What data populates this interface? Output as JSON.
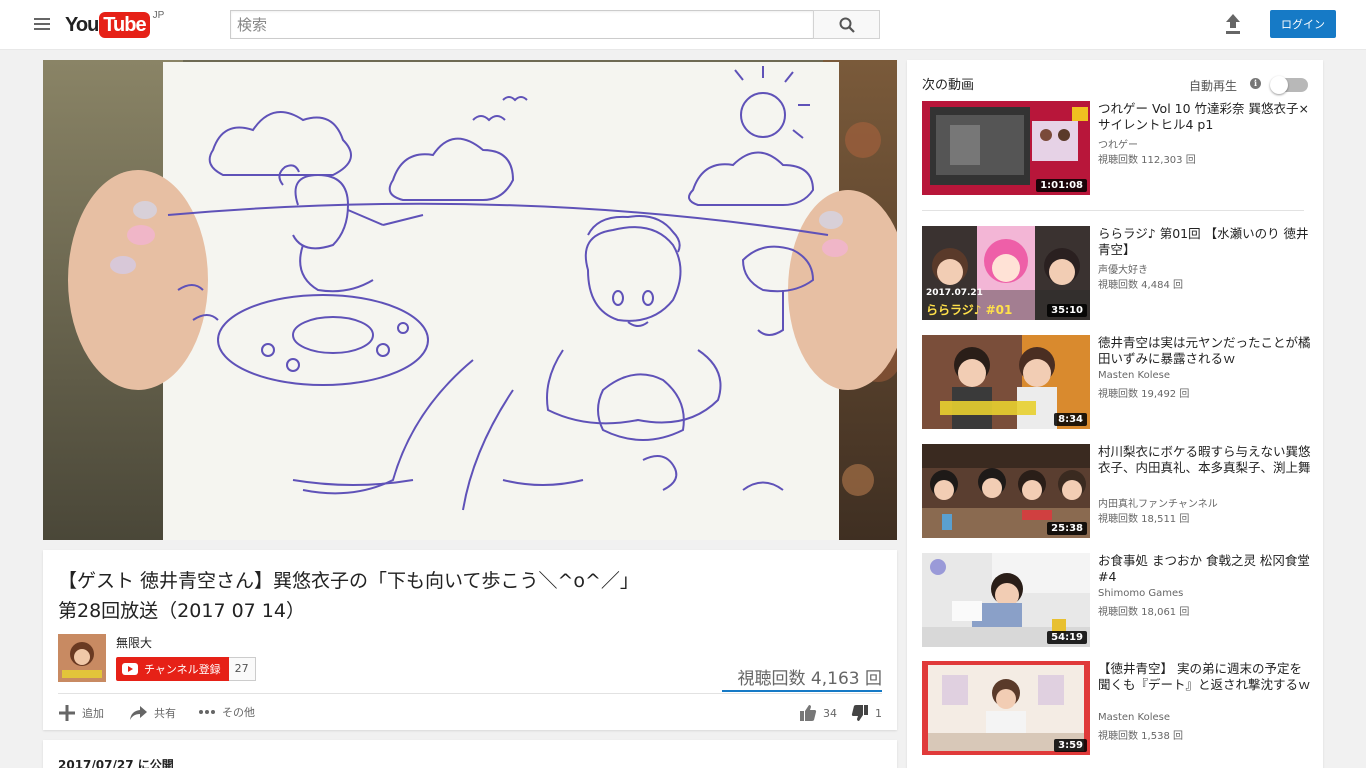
{
  "header": {
    "logo_you": "You",
    "logo_tube": "Tube",
    "logo_region": "JP",
    "search_placeholder": "検索",
    "login_label": "ログイン"
  },
  "video": {
    "title_line1": "【ゲスト 徳井青空さん】巽悠衣子の「下も向いて歩こう＼^o^／」",
    "title_line2": "第28回放送（2017 07 14）",
    "channel_name": "無限大",
    "subscribe_label": "チャンネル登録",
    "subscriber_count": "27",
    "views": "視聴回数 4,163 回",
    "actions": {
      "add": "追加",
      "share": "共有",
      "more": "その他",
      "likes": "34",
      "dislikes": "1"
    },
    "published": "2017/07/27 に公開"
  },
  "sidebar": {
    "up_next": "次の動画",
    "autoplay_label": "自動再生",
    "autoplay_info": "i",
    "items": [
      {
        "title": "つれゲー Vol 10 竹達彩奈 巽悠衣子×サイレントヒル4 p1",
        "channel": "つれゲー",
        "views": "視聴回数 112,303 回",
        "duration": "1:01:08"
      },
      {
        "title": "ららラジ♪ 第01回 【水瀬いのり 徳井青空】",
        "channel": "声優大好き",
        "views": "視聴回数 4,484 回",
        "duration": "35:10",
        "overlay_date": "2017.07.21",
        "overlay_title": "ららラジ♪ #01"
      },
      {
        "title": "徳井青空は実は元ヤンだったことが橘田いずみに暴露されるｗ",
        "channel": "Masten Kolese",
        "views": "視聴回数 19,492 回",
        "duration": "8:34"
      },
      {
        "title": "村川梨衣にボケる暇すら与えない巽悠衣子、内田真礼、本多真梨子、渕上舞",
        "channel": "内田真礼ファンチャンネル",
        "views": "視聴回数 18,511 回",
        "duration": "25:38"
      },
      {
        "title": "お食事処 まつおか 食戟之灵 松冈食堂 #4",
        "channel": "Shimomo Games",
        "views": "視聴回数 18,061 回",
        "duration": "54:19"
      },
      {
        "title": "【徳井青空】 実の弟に週末の予定を聞くも『デート』と返され撃沈するｗ",
        "channel": "Masten Kolese",
        "views": "視聴回数 1,538 回",
        "duration": "3:59"
      }
    ]
  }
}
